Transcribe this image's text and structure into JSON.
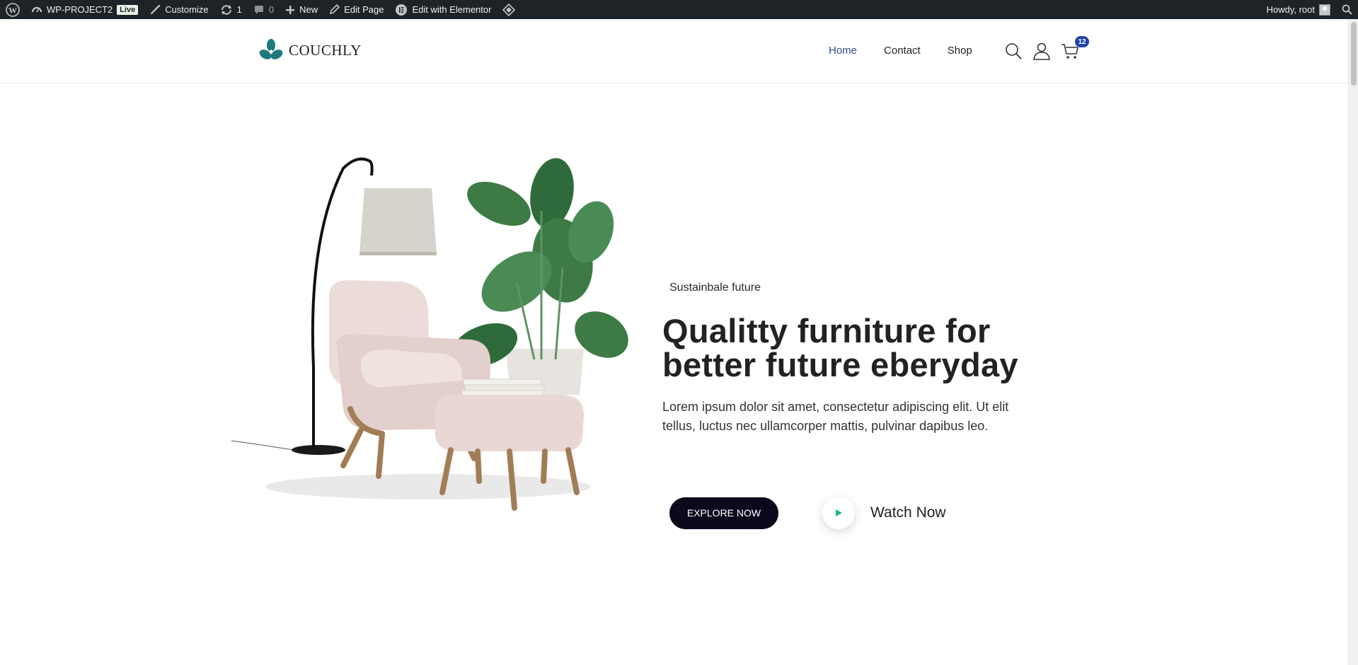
{
  "adminbar": {
    "site_name": "WP-PROJECT2",
    "live_badge": "Live",
    "customize": "Customize",
    "updates_count": "1",
    "comments_count": "0",
    "new": "New",
    "edit_page": "Edit Page",
    "edit_elementor": "Edit with Elementor",
    "howdy": "Howdy, root"
  },
  "header": {
    "logo_text": "COUCHLY",
    "nav": [
      "Home",
      "Contact",
      "Shop"
    ],
    "active_nav": "Home",
    "cart_count": "12",
    "icons": [
      "search-icon",
      "user-icon",
      "cart-icon"
    ]
  },
  "hero": {
    "eyebrow": "Sustainbale future",
    "headline_line1": "Qualitty furniture for",
    "headline_line2": "better future eberyday",
    "description": "Lorem ipsum dolor sit amet, consectetur adipiscing elit. Ut elit tellus, luctus nec ullamcorper mattis, pulvinar dapibus leo.",
    "explore_button": "EXPLORE NOW",
    "watch_label": "Watch Now"
  },
  "colors": {
    "adminbar_bg": "#1d2327",
    "logo_teal": "#1f7a7f",
    "nav_active": "#2b4a8b",
    "cart_badge": "#1e44a8",
    "button_bg": "#0b0a1d",
    "play_green": "#22b573"
  }
}
